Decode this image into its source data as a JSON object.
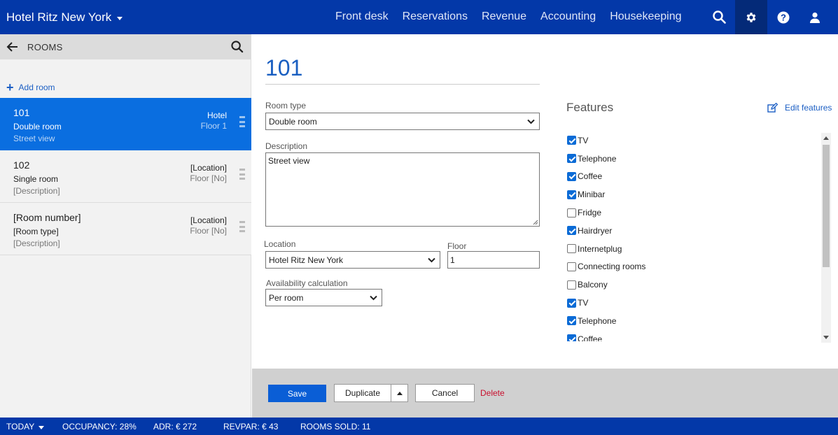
{
  "header": {
    "hotel_name": "Hotel Ritz New York",
    "nav": [
      "Front desk",
      "Reservations",
      "Revenue",
      "Accounting",
      "Housekeeping"
    ],
    "icons": [
      "search-icon",
      "gear-icon",
      "help-icon",
      "user-icon"
    ]
  },
  "sidebar": {
    "title": "ROOMS",
    "add_label": "Add room",
    "rooms": [
      {
        "number": "101",
        "type": "Double room",
        "description": "Street view",
        "location": "Hotel",
        "floor": "Floor 1"
      },
      {
        "number": "102",
        "type": "Single room",
        "description": "[Description]",
        "location": "[Location]",
        "floor": "Floor [No]"
      },
      {
        "number": "[Room number]",
        "type": "[Room type]",
        "description": "[Description]",
        "location": "[Location]",
        "floor": "Floor [No]"
      }
    ]
  },
  "form": {
    "title": "101",
    "room_type_label": "Room type",
    "room_type_value": "Double room",
    "description_label": "Description",
    "description_value": "Street view",
    "location_label": "Location",
    "location_value": "Hotel Ritz New York",
    "floor_label": "Floor",
    "floor_value": "1",
    "availability_label": "Availability calculation",
    "availability_value": "Per room"
  },
  "features": {
    "title": "Features",
    "edit_label": "Edit features",
    "items": [
      {
        "label": "TV",
        "checked": true
      },
      {
        "label": "Telephone",
        "checked": true
      },
      {
        "label": "Coffee",
        "checked": true
      },
      {
        "label": "Minibar",
        "checked": true
      },
      {
        "label": "Fridge",
        "checked": false
      },
      {
        "label": "Hairdryer",
        "checked": true
      },
      {
        "label": "Internetplug",
        "checked": false
      },
      {
        "label": "Connecting rooms",
        "checked": false
      },
      {
        "label": "Balcony",
        "checked": false
      },
      {
        "label": "TV",
        "checked": true
      },
      {
        "label": "Telephone",
        "checked": true
      },
      {
        "label": "Coffee",
        "checked": true
      }
    ]
  },
  "actions": {
    "save": "Save",
    "duplicate": "Duplicate",
    "cancel": "Cancel",
    "delete": "Delete"
  },
  "status": {
    "today": "TODAY",
    "occupancy": "OCCUPANCY: 28%",
    "adr": "ADR: € 272",
    "revpar": "REVPAR: € 43",
    "rooms_sold": "ROOMS SOLD: 11"
  },
  "colors": {
    "brand": "#0338a8",
    "accent": "#0a6ee0",
    "delete": "#c8102e"
  }
}
